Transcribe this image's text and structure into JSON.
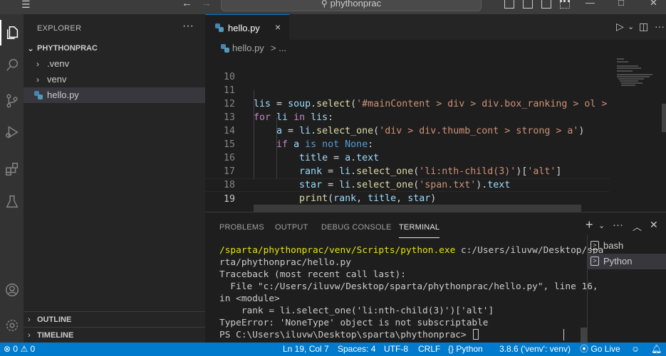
{
  "titlebar": {
    "search_text": "phythonprac",
    "icons": [
      "menu-icon",
      "back-arrow-icon",
      "forward-arrow-icon",
      "search-icon",
      "toggle-sidebar-icon",
      "toggle-panel-icon",
      "toggle-secondary-sidebar-icon",
      "customize-layout-icon",
      "minimize-icon",
      "maximize-icon",
      "close-icon"
    ]
  },
  "activity_bar": {
    "items": [
      "explorer-icon",
      "search-icon",
      "source-control-icon",
      "run-debug-icon",
      "extensions-icon",
      "testing-icon",
      "accounts-icon",
      "manage-gear-icon"
    ]
  },
  "sidebar": {
    "header": "EXPLORER",
    "more": "···",
    "root": "PHYTHONPRAC",
    "items": [
      {
        "label": ".venv",
        "kind": "folder"
      },
      {
        "label": "venv",
        "kind": "folder"
      },
      {
        "label": "hello.py",
        "kind": "python-file",
        "selected": true
      }
    ],
    "sections": [
      "OUTLINE",
      "TIMELINE"
    ]
  },
  "editor": {
    "tab_label": "hello.py",
    "tab_close": "×",
    "breadcrumb_file": "hello.py",
    "breadcrumb_rest": "> ...",
    "line_numbers": [
      "10",
      "11",
      "12",
      "13",
      "14",
      "15",
      "16",
      "17",
      "18",
      "19"
    ],
    "lines": [
      "",
      "lis = soup.select('#mainContent > div > div.box_ranking > ol > li",
      "for li in lis:",
      "    a = li.select_one('div > div.thumb_cont > strong > a')",
      "    if a is not None:",
      "        title = a.text",
      "        rank = li.select_one('li:nth-child(3)')['alt']",
      "        star = li.select_one('span.txt').text",
      "        print(rank, title, star)",
      ""
    ],
    "current_line": "19"
  },
  "panel": {
    "tabs": [
      "PROBLEMS",
      "OUTPUT",
      "DEBUG CONSOLE",
      "TERMINAL"
    ],
    "active_tab": "TERMINAL",
    "terminal_lines": [
      {
        "text": "/sparta/phythonprac/venv/Scripts/python.exe",
        "tail": " c:/Users/iluvw/Desktop/spa"
      },
      {
        "text": "rta/phythonprac/hello.py",
        "tail": ""
      },
      {
        "text": "Traceback (most recent call last):",
        "tail": ""
      },
      {
        "text": "  File \"c:/Users/iluvw/Desktop/sparta/phythonprac/hello.py\", line 16,",
        "tail": ""
      },
      {
        "text": "in <module>",
        "tail": ""
      },
      {
        "text": "    rank = li.select_one('li:nth-child(3)')['alt']",
        "tail": ""
      },
      {
        "text": "TypeError: 'NoneType' object is not subscriptable",
        "tail": ""
      },
      {
        "text": "PS C:\\Users\\iluvw\\Desktop\\sparta\\phythonprac> ",
        "tail": ""
      }
    ],
    "terminals": [
      {
        "label": "bash",
        "selected": false
      },
      {
        "label": "Python",
        "selected": true
      }
    ]
  },
  "statusbar": {
    "errors": "0",
    "warnings": "0",
    "position": "Ln 19, Col 7",
    "spaces": "Spaces: 4",
    "encoding": "UTF-8",
    "eol": "CRLF",
    "language": "Python",
    "interpreter": "3.8.6 ('venv': venv)",
    "golive": "Go Live"
  },
  "colors": {
    "accent": "#007acc",
    "terminal_yellow": "#e5e510",
    "keyword": "#c586c0",
    "string": "#ce9178"
  }
}
